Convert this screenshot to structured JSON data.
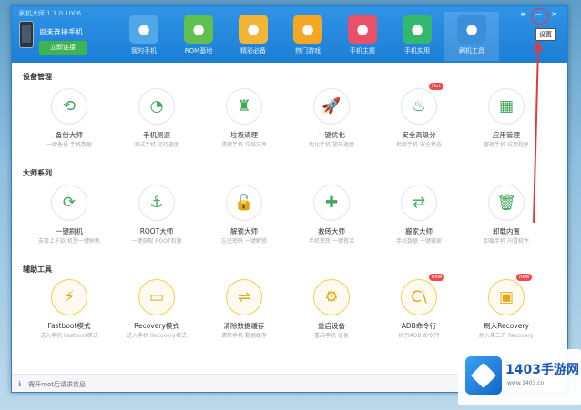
{
  "window": {
    "title": "刷机大师 1.1.0.1006"
  },
  "device": {
    "name": "尚未连接手机",
    "connect_label": "立即连接"
  },
  "nav": [
    {
      "label": "我的手机",
      "icon": "cloud-icon",
      "color": "#52a7ea"
    },
    {
      "label": "ROM基地",
      "icon": "shopping-bag-icon",
      "color": "#5fbf4f"
    },
    {
      "label": "精彩必备",
      "icon": "image-icon",
      "color": "#f2b535"
    },
    {
      "label": "热门游戏",
      "icon": "smiley-icon",
      "color": "#f5a623"
    },
    {
      "label": "手机主题",
      "icon": "shirt-icon",
      "color": "#e9506a"
    },
    {
      "label": "手机实用",
      "icon": "shield-icon",
      "color": "#34b86e"
    },
    {
      "label": "刷机工具",
      "icon": "tools-icon",
      "color": "#3a8fd8"
    }
  ],
  "window_controls": {
    "settings": "≡",
    "minimize": "—",
    "close": "×"
  },
  "settings_tooltip": "设置",
  "sections": {
    "device_mgmt": "设备管理",
    "master_series": "大师系列",
    "aux_tools": "辅助工具"
  },
  "tools_row1": [
    {
      "name": "备份大师",
      "desc": "一键备份 手机数据",
      "icon": "refresh-icon",
      "glyph": "⟲"
    },
    {
      "name": "手机测速",
      "desc": "测试手机 运行速度",
      "icon": "gauge-icon",
      "glyph": "◔"
    },
    {
      "name": "垃圾清理",
      "desc": "清理手机 垃圾文件",
      "icon": "broom-icon",
      "glyph": "♜"
    },
    {
      "name": "一键优化",
      "desc": "优化手机 提升速度",
      "icon": "rocket-icon",
      "glyph": "🚀"
    },
    {
      "name": "安全高级分",
      "desc": "检测手机 安全状态",
      "icon": "fire-shield-icon",
      "glyph": "♨",
      "badge": "Hot"
    },
    {
      "name": "应用管理",
      "desc": "管理手机 应用程序",
      "icon": "grid-icon",
      "glyph": "▦"
    }
  ],
  "tools_row2": [
    {
      "name": "一键刷机",
      "desc": "支持上千款 机型一键刷机",
      "icon": "sync-icon",
      "glyph": "⟳"
    },
    {
      "name": "ROOT大师",
      "desc": "一键获取 ROOT权限",
      "icon": "anchor-icon",
      "glyph": "⚓"
    },
    {
      "name": "解锁大师",
      "desc": "忘记密码 一键解锁",
      "icon": "unlock-icon",
      "glyph": "🔓"
    },
    {
      "name": "救砖大师",
      "desc": "手机变砖 一键救活",
      "icon": "phone-plus-icon",
      "glyph": "✚"
    },
    {
      "name": "搬家大师",
      "desc": "手机数据 一键搬家",
      "icon": "transfer-icon",
      "glyph": "⇄"
    },
    {
      "name": "卸载内置",
      "desc": "卸载手机 内置软件",
      "icon": "trash-icon",
      "glyph": "🗑"
    }
  ],
  "tools_row3": [
    {
      "name": "Fastboot模式",
      "desc": "进入手机 Fastboot模式",
      "icon": "lightning-icon",
      "glyph": "⚡"
    },
    {
      "name": "Recovery模式",
      "desc": "进入手机 Recovery模式",
      "icon": "tablet-icon",
      "glyph": "▭"
    },
    {
      "name": "清除数据缓存",
      "desc": "清除手机 数据缓存",
      "icon": "shuffle-icon",
      "glyph": "⇌"
    },
    {
      "name": "重启设备",
      "desc": "重启手机 设备",
      "icon": "gear-icon",
      "glyph": "⚙"
    },
    {
      "name": "ADB命令行",
      "desc": "执行ADB 命令行",
      "icon": "terminal-icon",
      "glyph": "C\\",
      "badge": "new"
    },
    {
      "name": "刷入Recovery",
      "desc": "刷入第三方 Recovery",
      "icon": "sd-card-icon",
      "glyph": "▣",
      "badge": "new"
    }
  ],
  "status": {
    "text": "需开root后请求信息"
  },
  "watermark": {
    "text": "1403手游网",
    "sub": "www.1403.cn"
  }
}
